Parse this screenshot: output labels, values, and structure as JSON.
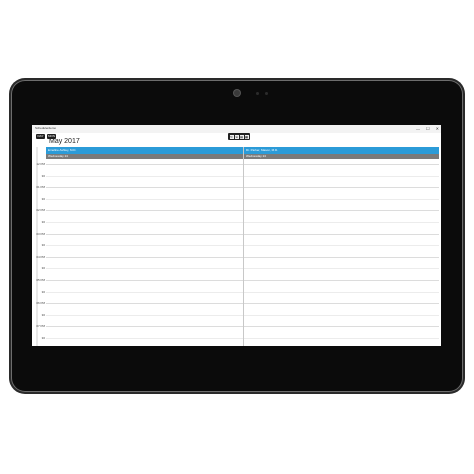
{
  "window": {
    "title": "Schedulerdemo",
    "minimize": "—",
    "maximize": "☐",
    "close": "✕"
  },
  "toolbar": {
    "views": [
      "DAY",
      "MON"
    ],
    "tools": [
      "↻",
      "⇲",
      "▤",
      "▦"
    ]
  },
  "calendar": {
    "month_title": "May 2017",
    "columns": [
      {
        "resource": "Emeline Ashley, M.D.",
        "day": "Wednesday 24"
      },
      {
        "resource": "Dr. Parker, Mason, M.D.",
        "day": "Wednesday 24"
      }
    ],
    "time_labels": [
      "12 PM",
      "30",
      "01 PM",
      "30",
      "02 PM",
      "30",
      "03 PM",
      "30",
      "04 PM",
      "30",
      "05 PM",
      "30",
      "06 PM",
      "30",
      "07 PM",
      "30"
    ]
  },
  "colors": {
    "header_accent": "#2b9bd8",
    "day_bar": "#7a7a7a",
    "device_bezel": "#0b0b0b"
  }
}
